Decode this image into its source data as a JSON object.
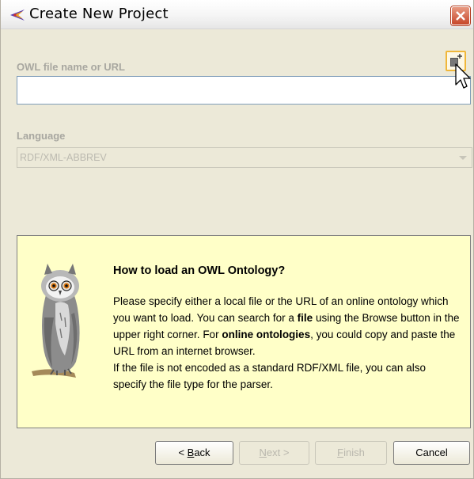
{
  "window": {
    "title": "Create New Project"
  },
  "owl_file": {
    "label": "OWL file name or URL",
    "value": "",
    "placeholder": ""
  },
  "language": {
    "label": "Language",
    "selected": "RDF/XML-ABBREV"
  },
  "help": {
    "title": "How to load an OWL Ontology?",
    "text_1": "Please specify either a local file or the URL of an online ontology which you want to load. You can search for a ",
    "bold_file": "file",
    "text_2": " using the Browse button in the upper right corner. For ",
    "bold_online": "online ontologies",
    "text_3": ", you could copy and paste the URL from an internet browser.",
    "text_4": "If the file is not encoded as a standard RDF/XML file, you can also specify the file type for the parser."
  },
  "buttons": {
    "back_prefix": "< ",
    "back_mnemonic": "B",
    "back_rest": "ack",
    "next_mnemonic": "N",
    "next_rest": "ext >",
    "finish_mnemonic": "F",
    "finish_rest": "inish",
    "cancel": "Cancel"
  },
  "icons": {
    "app": "protege-icon",
    "browse": "new-file-icon",
    "owl": "owl-illustration"
  },
  "colors": {
    "help_background": "#ffffc8",
    "dialog_background": "#ece9d8",
    "disabled_text": "#a8a7a0",
    "close_button": "#c6462a"
  }
}
